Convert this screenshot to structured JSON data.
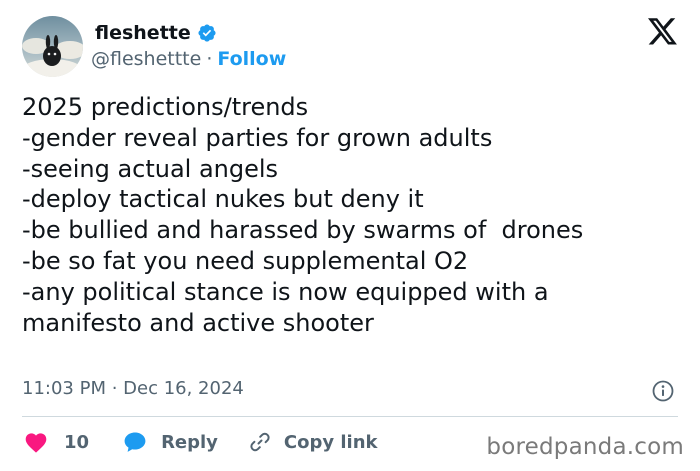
{
  "author": {
    "display_name": "fleshette",
    "handle": "@fleshettte",
    "separator": "·",
    "follow_label": "Follow",
    "verified": true
  },
  "tweet": {
    "lines": [
      "2025 predictions/trends",
      "",
      "-gender reveal parties for grown adults",
      "-seeing actual angels",
      "-deploy tactical nukes but deny it",
      "-be bullied and harassed by swarms of  drones",
      "-be so fat you need supplemental O2",
      "-any political stance is now equipped with a",
      "manifesto and active shooter"
    ],
    "timestamp": "11:03 PM · Dec 16, 2024"
  },
  "actions": {
    "like_count": "10",
    "reply_label": "Reply",
    "copy_link_label": "Copy link"
  },
  "watermark": "boredpanda.com",
  "colors": {
    "accent": "#1d9bf0",
    "like": "#f91880",
    "text": "#0f1419",
    "muted": "#536471"
  },
  "icons": [
    "verified-badge-icon",
    "x-logo-icon",
    "info-icon",
    "heart-icon",
    "reply-bubble-icon",
    "link-icon"
  ]
}
